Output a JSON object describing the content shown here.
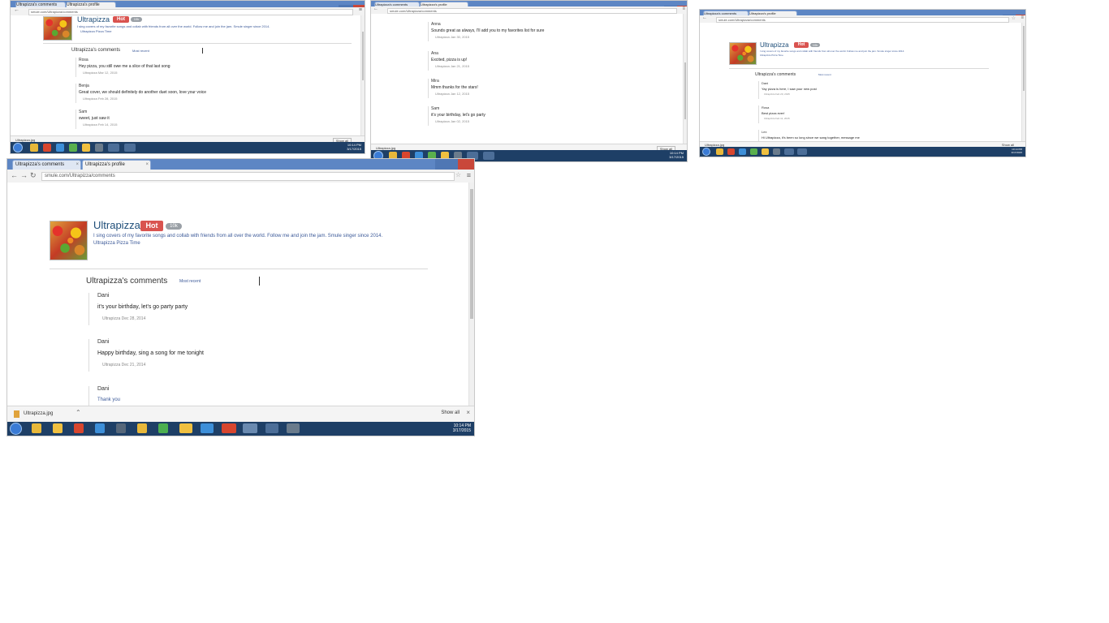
{
  "browser": {
    "tabs": [
      "Ultrapizza's comments",
      "Ultrapizza's profile"
    ],
    "url": "smule.com/Ultrapizza/comments",
    "download_file": "Ultrapizza.jpg",
    "show_all_label": "Show all"
  },
  "profile": {
    "username": "Ultrapizza",
    "hot_badge": "Hot",
    "level_badge": "10k",
    "bio": "I sing covers of my favorite songs and collab with friends from all over the world. Follow me and join the jam. Smule singer since 2014.",
    "bio_line2": "Ultrapizza   Pizza Time"
  },
  "comments_section": {
    "title": "Ultrapizza's comments",
    "sort_label": "Most recent"
  },
  "screens": {
    "top_left": {
      "comments": [
        {
          "author": "Rosa",
          "text": "Hey pizza, you still owe me a slice of that last song",
          "meta": "Ultrapizza   Mar 12, 2015"
        },
        {
          "author": "Benja",
          "text": "Great cover, we should definitely do another duet soon, love your voice",
          "meta": "Ultrapizza   Feb 28, 2015"
        },
        {
          "author": "Sam",
          "text": "sweet, just saw it",
          "meta": "Ultrapizza   Feb 14, 2015"
        }
      ]
    },
    "top_middle": {
      "comments": [
        {
          "author": "Anna",
          "text": "Sounds great as always, I'll add you to my favorites list for sure",
          "meta": "Ultrapizza   Jan 30, 2015"
        },
        {
          "author": "Ana",
          "text": "Excited, pizza is up!",
          "meta": "Ultrapizza   Jan 21, 2015"
        },
        {
          "author": "Mira",
          "text": "Mmm thanks for the stars!",
          "meta": "Ultrapizza   Jan 12, 2015"
        },
        {
          "author": "Sam",
          "text": "it's your birthday, let's go party",
          "meta": "Ultrapizza   Jan 02, 2015"
        }
      ]
    },
    "top_right": {
      "comments": [
        {
          "author": "Dani",
          "text": "Yay pizza is here, I saw your new post",
          "meta": "Ultrapizza   Feb 20, 2015"
        },
        {
          "author": "Rosa",
          "text": "Best pizza ever!",
          "meta": "Ultrapizza   Feb 11, 2015"
        },
        {
          "author": "Lex",
          "text": "Hi Ultrapizza, it's been so long since we sang together, message me",
          "meta": ""
        }
      ]
    },
    "main": {
      "comments": [
        {
          "author": "Dani",
          "text": "it's your birthday, let's go party party",
          "meta": "Ultrapizza   Dec 28, 2014"
        },
        {
          "author": "Dani",
          "text": "Happy birthday, sing a song for me tonight",
          "meta": "Ultrapizza   Dec 21, 2014"
        },
        {
          "author": "Dani",
          "text": "Thank you",
          "meta": ""
        }
      ]
    }
  },
  "taskbar": {
    "time": "10:14 PM",
    "date": "3/17/2015"
  },
  "colors": {
    "tabbar": "#5d86c4",
    "taskbar": "#1e3f66",
    "hot_badge": "#d9534f",
    "link": "#3b5998"
  }
}
